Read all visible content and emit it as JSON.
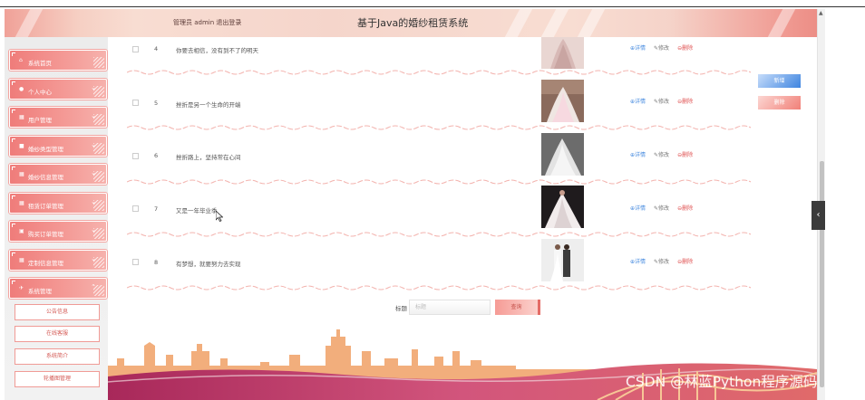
{
  "header": {
    "user_text": "管理员 admin  退出登录",
    "title": "基于Java的婚纱租赁系统"
  },
  "sidebar": {
    "items": [
      {
        "label": "系统首页",
        "icon": "home-icon",
        "glyph": "⌂",
        "chevron": ""
      },
      {
        "label": "个人中心",
        "icon": "person-icon",
        "glyph": "●",
        "chevron": "⌄"
      },
      {
        "label": "用户管理",
        "icon": "grid-icon",
        "glyph": "▦",
        "chevron": "⌄"
      },
      {
        "label": "婚纱类型管理",
        "icon": "list-icon",
        "glyph": "■",
        "chevron": "⌄"
      },
      {
        "label": "婚纱信息管理",
        "icon": "grid-icon",
        "glyph": "▦",
        "chevron": "⌄"
      },
      {
        "label": "租赁订单管理",
        "icon": "grid-icon",
        "glyph": "▦",
        "chevron": "⌄"
      },
      {
        "label": "购买订单管理",
        "icon": "image-icon",
        "glyph": "▣",
        "chevron": "⌄"
      },
      {
        "label": "定制信息管理",
        "icon": "grid-icon",
        "glyph": "▦",
        "chevron": "⌄"
      },
      {
        "label": "系统管理",
        "icon": "plane-icon",
        "glyph": "✈",
        "chevron": "⌃"
      }
    ],
    "sub_items": [
      "公告信息",
      "在线客服",
      "系统简介",
      "轮播图管理"
    ]
  },
  "table": {
    "rows": [
      {
        "num": "4",
        "title": "你要去相信，没有到不了的明天"
      },
      {
        "num": "5",
        "title": "挫折是另一个生命的开端"
      },
      {
        "num": "6",
        "title": "挫折路上，坚持常在心间"
      },
      {
        "num": "7",
        "title": "又是一年毕业季"
      },
      {
        "num": "8",
        "title": "有梦想，就要努力去实现"
      }
    ],
    "actions": {
      "detail": "⊕详情",
      "edit": "✎修改",
      "delete": "⊖删除"
    }
  },
  "buttons": {
    "add": "新增",
    "delete": "删除"
  },
  "search": {
    "label": "标题",
    "placeholder": "标题",
    "button": "查询"
  },
  "watermark": "CSDN @林蓝Python程序源码",
  "colors": {
    "accent": "#f0857f",
    "link_blue": "#4a8de0",
    "delete_red": "#e05252",
    "footer_city": "#f0a873",
    "footer_magenta": "#c73a6a"
  }
}
